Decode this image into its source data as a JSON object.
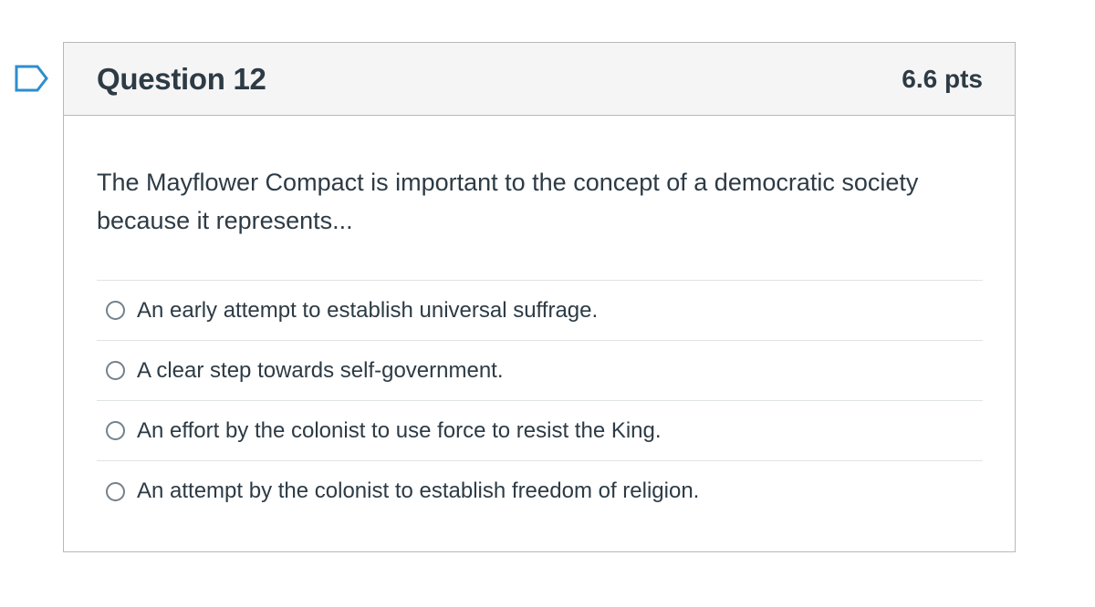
{
  "colors": {
    "flag": "#2d8ecf",
    "text": "#2d3b45",
    "header_bg": "#f5f5f5",
    "border": "#b5b9bd",
    "divider": "#e0e3e5",
    "radio_border": "#73818a"
  },
  "flag": {
    "icon": "bookmark-flag-icon"
  },
  "question": {
    "title": "Question 12",
    "points": "6.6 pts",
    "text": "The Mayflower Compact is important to the concept of a democratic society because it represents...",
    "answers": [
      {
        "label": "An early attempt to establish universal suffrage.",
        "selected": false
      },
      {
        "label": "A clear step towards self-government.",
        "selected": false
      },
      {
        "label": "An effort by the colonist to use force to resist the King.",
        "selected": false
      },
      {
        "label": "An attempt by the colonist to establish freedom of religion.",
        "selected": false
      }
    ]
  }
}
